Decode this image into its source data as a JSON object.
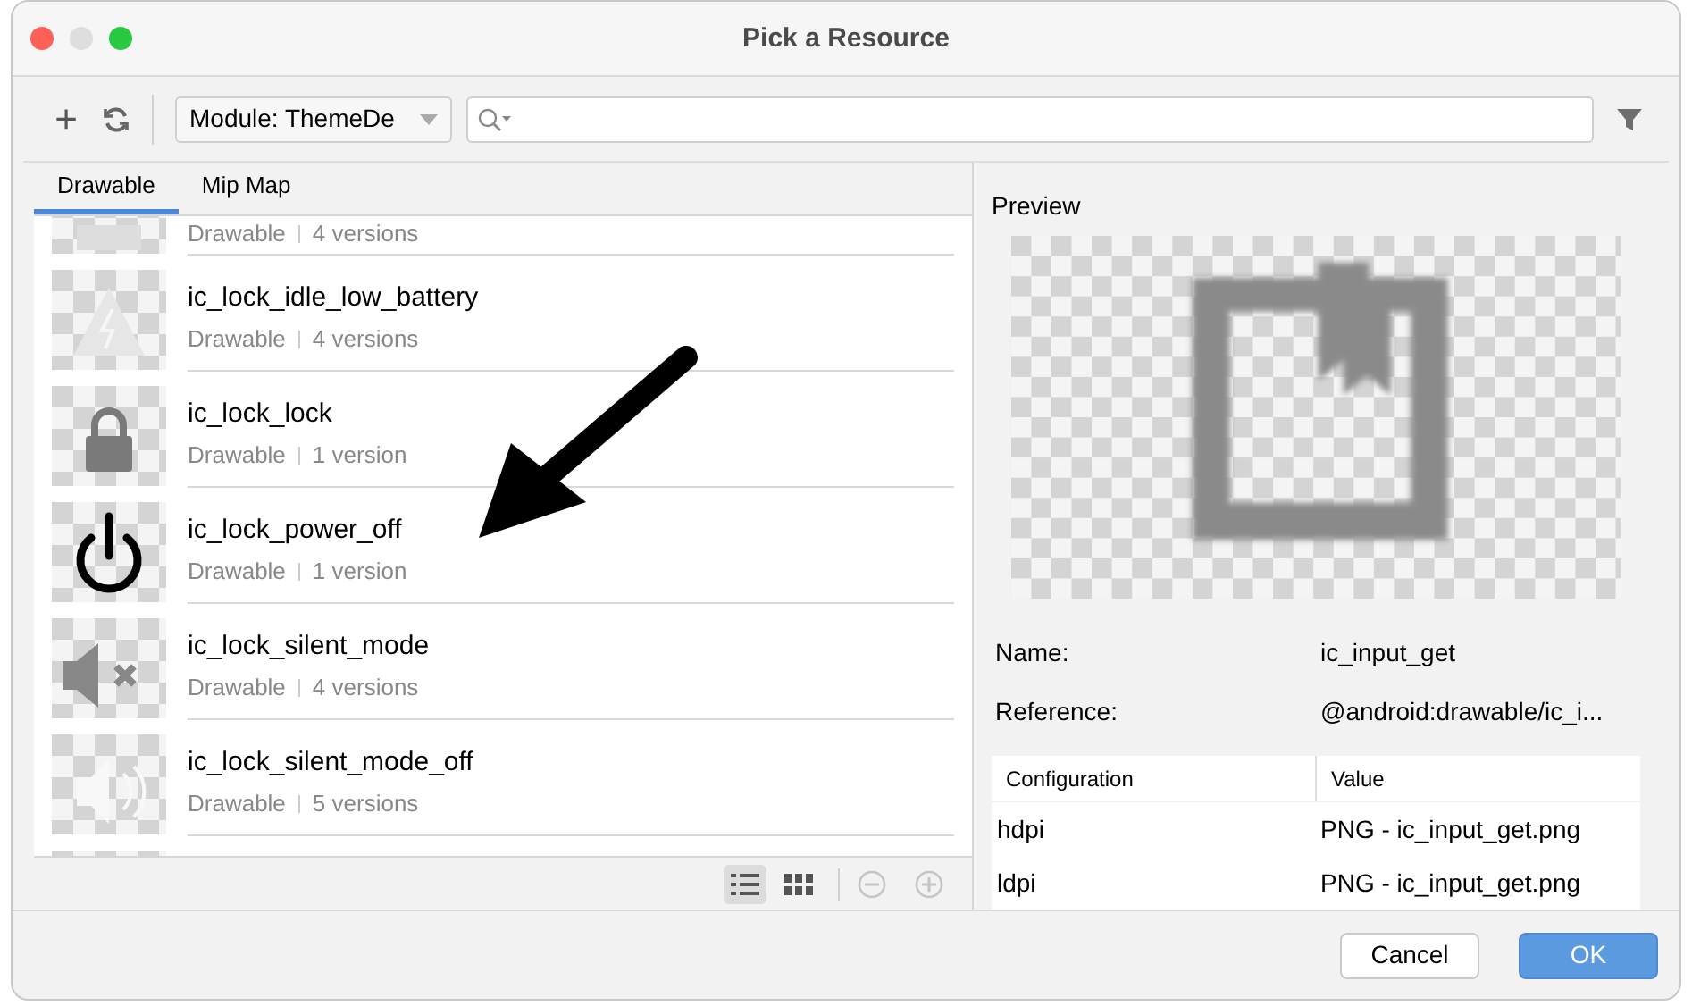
{
  "window": {
    "title": "Pick a Resource"
  },
  "toolbar": {
    "add": "+",
    "module": "Module: ThemeDe"
  },
  "tabs": [
    {
      "label": "Drawable",
      "selected": true
    },
    {
      "label": "Mip Map",
      "selected": false
    }
  ],
  "resources": [
    {
      "kind": "partial",
      "type": "Drawable",
      "versions": "4 versions"
    },
    {
      "kind": "battery",
      "name": "ic_lock_idle_low_battery",
      "type": "Drawable",
      "versions": "4 versions"
    },
    {
      "kind": "lock",
      "name": "ic_lock_lock",
      "type": "Drawable",
      "versions": "1 version"
    },
    {
      "kind": "power",
      "name": "ic_lock_power_off",
      "type": "Drawable",
      "versions": "1 version"
    },
    {
      "kind": "mute",
      "name": "ic_lock_silent_mode",
      "type": "Drawable",
      "versions": "4 versions"
    },
    {
      "kind": "speaker",
      "name": "ic_lock_silent_mode_off",
      "type": "Drawable",
      "versions": "5 versions"
    }
  ],
  "view_modes": [
    {
      "kind": "list",
      "selected": true
    },
    {
      "kind": "grid",
      "selected": false
    }
  ],
  "preview": {
    "title": "Preview",
    "fields": [
      {
        "label": "Name:",
        "value": "ic_input_get"
      },
      {
        "label": "Reference:",
        "value": "@android:drawable/ic_i..."
      }
    ],
    "table": {
      "columns": [
        "Configuration",
        "Value"
      ],
      "rows": [
        [
          "hdpi",
          "PNG - ic_input_get.png"
        ],
        [
          "ldpi",
          "PNG - ic_input_get.png"
        ]
      ]
    }
  },
  "buttons": [
    {
      "label": "Cancel",
      "kind": "secondary"
    },
    {
      "label": "OK",
      "kind": "primary"
    }
  ]
}
